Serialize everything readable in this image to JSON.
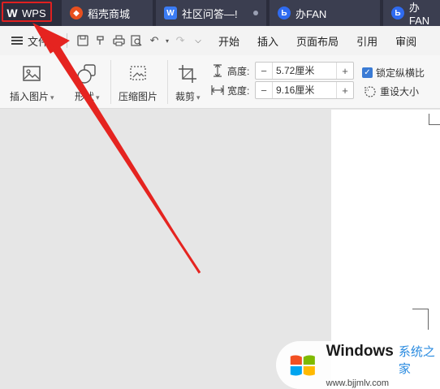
{
  "tabs": [
    {
      "label": "WPS"
    },
    {
      "label": "稻壳商城"
    },
    {
      "label": "社区问答—!"
    },
    {
      "label": "办FAN"
    },
    {
      "label": "办FAN"
    }
  ],
  "menubar": {
    "file_label": "文件",
    "items": [
      "开始",
      "插入",
      "页面布局",
      "引用",
      "审阅"
    ]
  },
  "ribbon": {
    "insert_image": "插入图片",
    "shape": "形状",
    "compress_image": "压缩图片",
    "crop": "裁剪",
    "height_label": "高度:",
    "height_value": "5.72厘米",
    "width_label": "宽度:",
    "width_value": "9.16厘米",
    "lock_ratio": "锁定纵横比",
    "lock_ratio_checked": true,
    "reset_size": "重设大小"
  },
  "watermark": {
    "brand": "Windows",
    "brand_cn": "系统之家",
    "url": "www.bjjmlv.com"
  },
  "colors": {
    "accent": "#3a7bd5",
    "highlight_red": "#e02020",
    "tabbar": "#2b2d3c"
  },
  "icons": [
    "wps-logo-icon",
    "daoke-icon",
    "doc-icon",
    "fan-icon",
    "menu-icon",
    "save-icon",
    "format-painter-icon",
    "print-icon",
    "print-preview-icon",
    "undo-icon",
    "redo-icon",
    "customize-icon",
    "insert-image-icon",
    "shape-icon",
    "compress-image-icon",
    "crop-icon",
    "height-icon",
    "width-icon",
    "reset-size-icon",
    "windows-logo-icon"
  ]
}
